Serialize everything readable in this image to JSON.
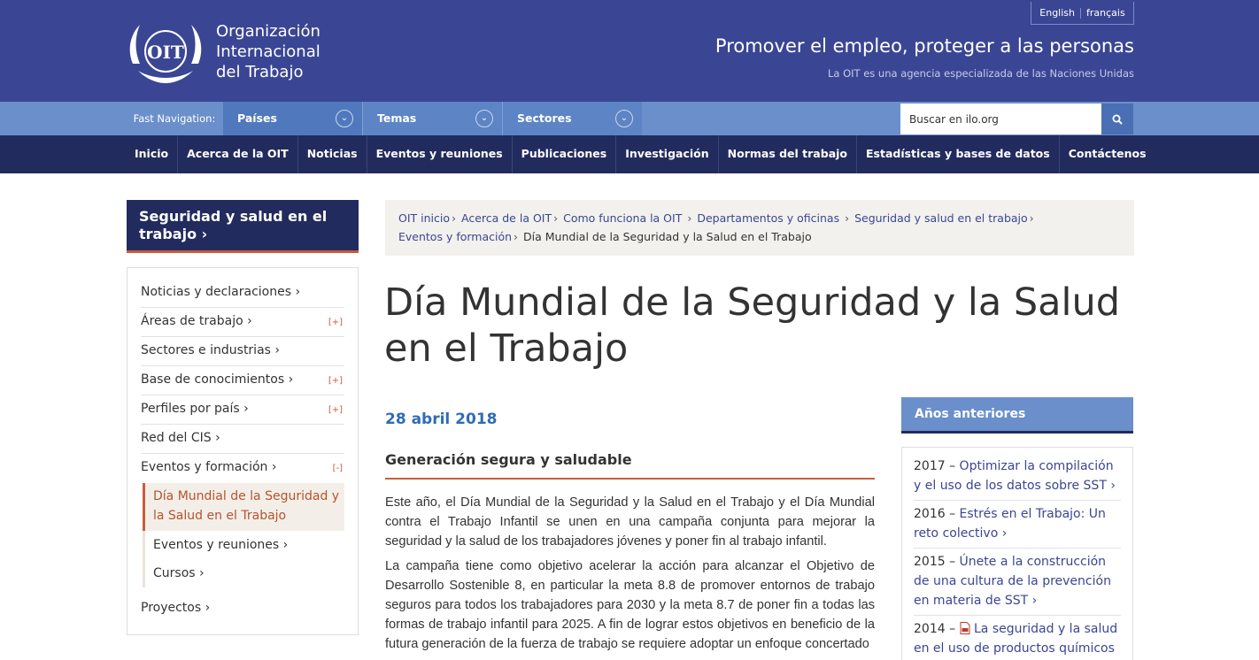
{
  "header": {
    "org_line1": "Organización",
    "org_line2": "Internacional",
    "org_line3": "del Trabajo",
    "logo_text": "OIT",
    "lang_en": "English",
    "lang_fr": "français",
    "tagline": "Promover el empleo, proteger a las personas",
    "subtagline": "La OIT es una agencia especializada de las Naciones Unidas"
  },
  "fastnav": {
    "label": "Fast Navigation:",
    "items": [
      "Países",
      "Temas",
      "Sectores"
    ],
    "search_placeholder": "Buscar en ilo.org"
  },
  "mainnav": [
    "Inicio",
    "Acerca de la OIT",
    "Noticias",
    "Eventos y reuniones",
    "Publicaciones",
    "Investigación",
    "Normas del trabajo",
    "Estadísticas y bases de datos",
    "Contáctenos"
  ],
  "sidebar": {
    "title": "Seguridad y salud en el trabajo ›",
    "items": [
      {
        "label": "Noticias y declaraciones ›",
        "plus": ""
      },
      {
        "label": "Áreas de trabajo ›",
        "plus": "[+]"
      },
      {
        "label": "Sectores e industrias ›",
        "plus": ""
      },
      {
        "label": "Base de conocimientos ›",
        "plus": "[+]"
      },
      {
        "label": "Perfiles por país ›",
        "plus": "[+]"
      },
      {
        "label": "Red del CIS ›",
        "plus": ""
      },
      {
        "label": "Eventos y formación ›",
        "plus": "[-]"
      }
    ],
    "sub_items": [
      "Día Mundial de la Seguridad y la Salud en el Trabajo",
      "Eventos y reuniones ›",
      "Cursos ›"
    ],
    "last_item": "Proyectos ›"
  },
  "breadcrumb": {
    "links": [
      "OIT inicio",
      "Acerca de la OIT",
      "Como funciona la OIT",
      "Departamentos y oficinas",
      "Seguridad y salud en el trabajo",
      "Eventos y formación"
    ],
    "current": "Día Mundial de la Seguridad y la Salud en el Trabajo"
  },
  "page": {
    "title": "Día Mundial de la Seguridad y la Salud en el Trabajo",
    "date": "28 abril 2018",
    "subhead": "Generación segura y saludable",
    "para1": "Este año, el Día Mundial de la Seguridad y la Salud en el Trabajo y el Día Mundial contra el Trabajo Infantil se unen en una campaña conjunta para mejorar la seguridad y la salud de los trabajadores jóvenes y poner fin al trabajo infantil.",
    "para2": "La campaña tiene como objetivo acelerar la acción para alcanzar el Objetivo de Desarrollo Sostenible 8, en particular la meta 8.8 de promover entornos de trabajo seguros para todos los trabajadores para 2030 y la meta 8.7 de poner fin a todas las formas de trabajo infantil para 2025. A fin de lograr estos objetivos en beneficio de la futura generación de la fuerza de trabajo se requiere adoptar un enfoque concertado"
  },
  "previous": {
    "title": "Años anteriores",
    "items": [
      {
        "year": "2017 –",
        "link": "Optimizar la compilación y el uso de los datos sobre SST ›"
      },
      {
        "year": "2016 –",
        "link": "Estrés en el Trabajo: Un reto colectivo ›"
      },
      {
        "year": "2015 –",
        "link": "Únete a la construcción de una cultura de la prevención en materia de SST ›"
      },
      {
        "year": "2014 –",
        "link": "La seguridad y la salud en el uso de productos químicos"
      }
    ]
  },
  "colors": {
    "header": "#3a4694",
    "fastnav": "#6b8fcb",
    "mainnav": "#222b5e",
    "accent": "#c75d3d",
    "link": "#3a4694"
  },
  "icons": [
    "ilo-logo-icon",
    "chevron-down-icon",
    "search-icon",
    "pdf-icon"
  ]
}
